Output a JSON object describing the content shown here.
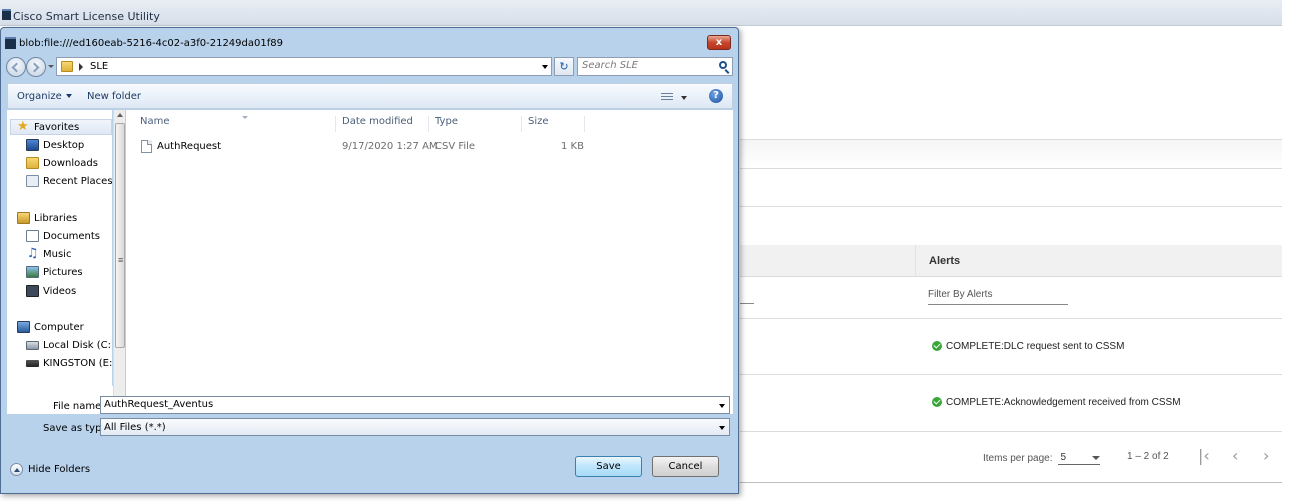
{
  "app": {
    "title": "Cisco Smart License Utility",
    "alerts_header": "Alerts",
    "filter_alerts_placeholder": "Filter By Alerts",
    "alerts": [
      "COMPLETE:DLC request sent to CSSM",
      "COMPLETE:Acknowledgement received from CSSM"
    ],
    "paginator": {
      "items_per_page_label": "Items per page:",
      "items_per_page_value": "5",
      "range": "1 – 2 of 2",
      "first_icon": "first-page-icon",
      "prev_icon": "prev-page-icon",
      "next_icon": "next-page-icon"
    },
    "accent_color": "#3aa63a"
  },
  "dialog": {
    "title": "blob:file:///ed160eab-5216-4c02-a3f0-21249da01f89",
    "close_label": "x",
    "address": {
      "crumb": "SLE",
      "search_placeholder": "Search SLE"
    },
    "toolbar": {
      "organize": "Organize",
      "new_folder": "New folder",
      "help": "?"
    },
    "nav": {
      "favorites": "Favorites",
      "favorites_items": [
        "Desktop",
        "Downloads",
        "Recent Places"
      ],
      "libraries": "Libraries",
      "libraries_items": [
        "Documents",
        "Music",
        "Pictures",
        "Videos"
      ],
      "computer": "Computer",
      "computer_items": [
        "Local Disk (C:)",
        "KINGSTON (E:)"
      ]
    },
    "columns": [
      "Name",
      "Date modified",
      "Type",
      "Size"
    ],
    "files": [
      {
        "name": "AuthRequest",
        "date": "9/17/2020 1:27 AM",
        "type": "CSV File",
        "size": "1 KB"
      }
    ],
    "file_name_label": "File name:",
    "file_name_value": "AuthRequest_Aventus",
    "save_type_label": "Save as type:",
    "save_type_value": "All Files (*.*)",
    "hide_folders": "Hide Folders",
    "save_button": "Save",
    "cancel_button": "Cancel"
  }
}
